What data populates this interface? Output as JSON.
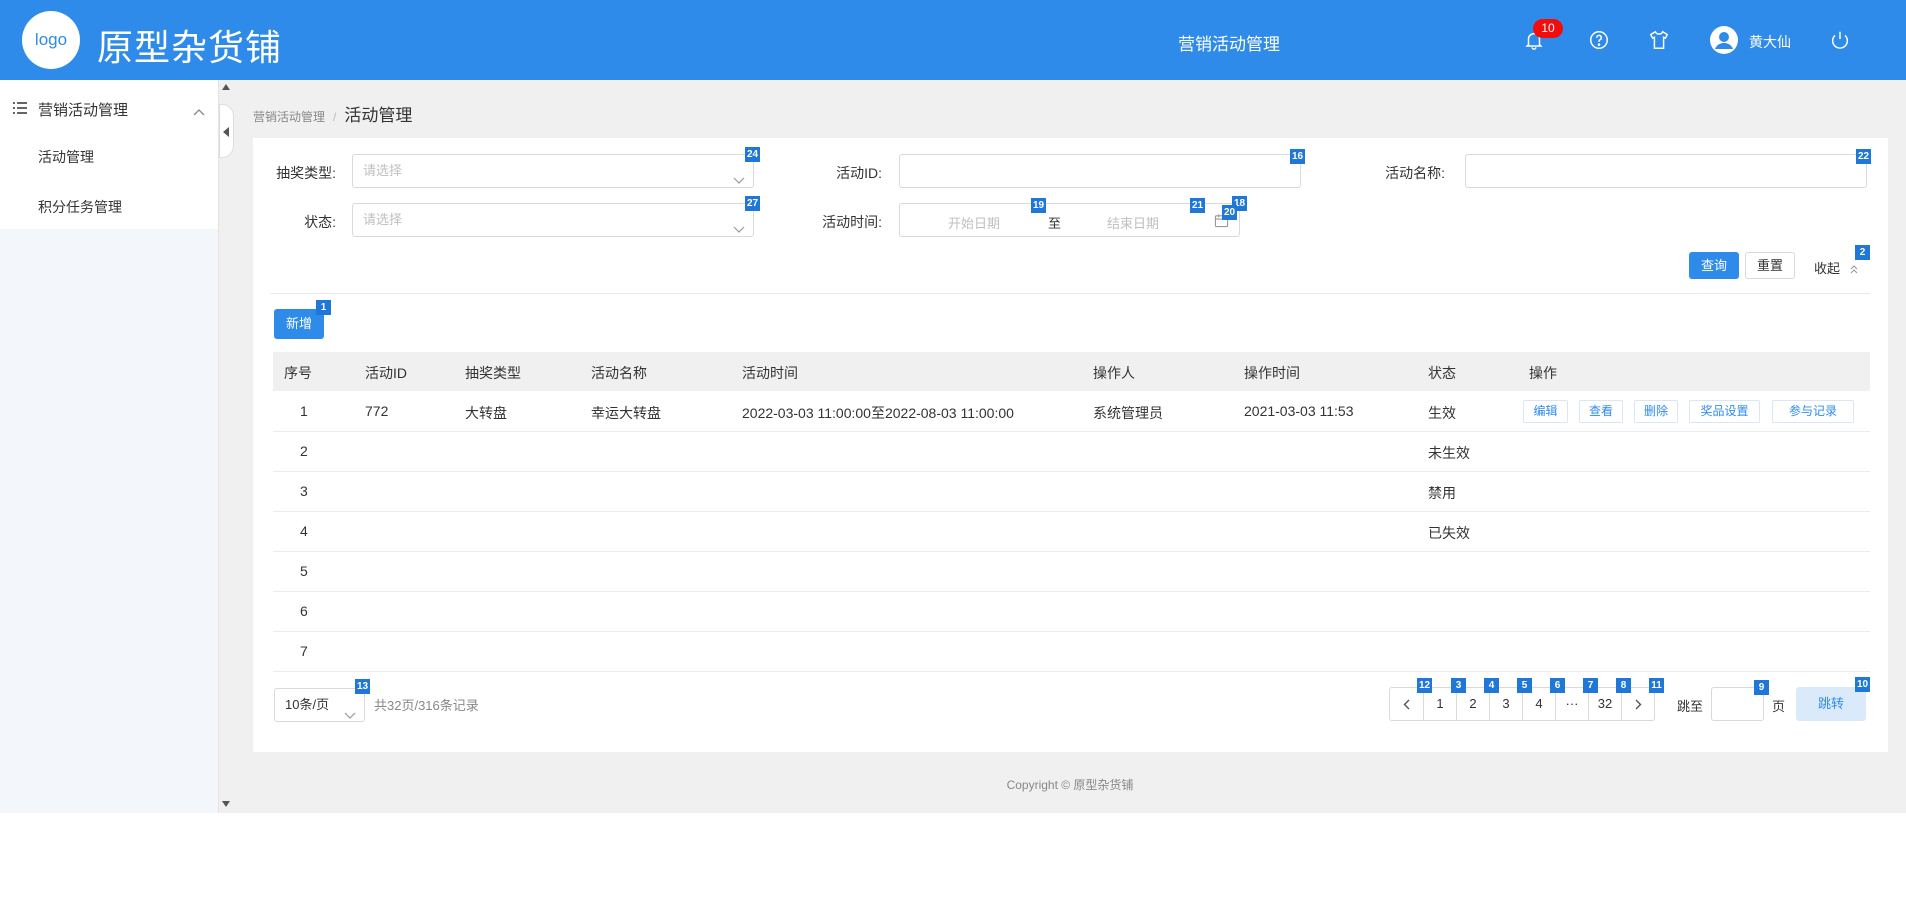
{
  "header": {
    "logo_text": "logo",
    "app_title": "原型杂货铺",
    "center_title": "营销活动管理",
    "notification_count": "10",
    "user_name": "黄大仙"
  },
  "sidebar": {
    "group_label": "营销活动管理",
    "items": [
      {
        "label": "活动管理"
      },
      {
        "label": "积分任务管理"
      }
    ]
  },
  "breadcrumb": {
    "parent": "营销活动管理",
    "separator": "/",
    "current": "活动管理"
  },
  "filters": {
    "lottery_type_label": "抽奖类型:",
    "lottery_type_placeholder": "请选择",
    "activity_id_label": "活动ID:",
    "activity_name_label": "活动名称:",
    "status_label": "状态:",
    "status_placeholder": "请选择",
    "activity_time_label": "活动时间:",
    "start_date_placeholder": "开始日期",
    "range_to": "至",
    "end_date_placeholder": "结束日期",
    "query_button": "查询",
    "reset_button": "重置",
    "collapse_link": "收起"
  },
  "toolbar": {
    "add_button": "新增"
  },
  "table": {
    "columns": [
      "序号",
      "活动ID",
      "抽奖类型",
      "活动名称",
      "活动时间",
      "操作人",
      "操作时间",
      "状态",
      "操作"
    ],
    "rows": [
      {
        "index": "1",
        "activity_id": "772",
        "lottery_type": "大转盘",
        "activity_name": "幸运大转盘",
        "activity_time": "2022-03-03 11:00:00至2022-08-03 11:00:00",
        "operator": "系统管理员",
        "operation_time": "2021-03-03 11:53",
        "status": "生效"
      },
      {
        "index": "2",
        "activity_id": "",
        "lottery_type": "",
        "activity_name": "",
        "activity_time": "",
        "operator": "",
        "operation_time": "",
        "status": "未生效"
      },
      {
        "index": "3",
        "activity_id": "",
        "lottery_type": "",
        "activity_name": "",
        "activity_time": "",
        "operator": "",
        "operation_time": "",
        "status": "禁用"
      },
      {
        "index": "4",
        "activity_id": "",
        "lottery_type": "",
        "activity_name": "",
        "activity_time": "",
        "operator": "",
        "operation_time": "",
        "status": "已失效"
      },
      {
        "index": "5",
        "activity_id": "",
        "lottery_type": "",
        "activity_name": "",
        "activity_time": "",
        "operator": "",
        "operation_time": "",
        "status": ""
      },
      {
        "index": "6",
        "activity_id": "",
        "lottery_type": "",
        "activity_name": "",
        "activity_time": "",
        "operator": "",
        "operation_time": "",
        "status": ""
      },
      {
        "index": "7",
        "activity_id": "",
        "lottery_type": "",
        "activity_name": "",
        "activity_time": "",
        "operator": "",
        "operation_time": "",
        "status": ""
      }
    ],
    "row_actions": [
      "编辑",
      "查看",
      "删除",
      "奖品设置",
      "参与记录"
    ]
  },
  "pagination": {
    "page_size": "10条/页",
    "total_text": "共32页/316条记录",
    "pages": [
      "1",
      "2",
      "3",
      "4",
      "···",
      "32"
    ],
    "jump_to_label": "跳至",
    "page_unit": "页",
    "jump_button": "跳转"
  },
  "element_tags": {
    "add": "1",
    "collapse": "2",
    "page1": "3",
    "page2": "4",
    "page3": "5",
    "page4": "6",
    "ellipsis": "7",
    "page32": "8",
    "jump_input": "9",
    "jump_button": "10",
    "next": "11",
    "prev": "12",
    "page_size": "13",
    "activity_id": "16",
    "calendar": "18",
    "start_date": "19",
    "calendar_right": "20",
    "end_date": "21",
    "activity_name": "22",
    "lottery_type": "24",
    "status": "27"
  },
  "footer": {
    "copyright": "Copyright © 原型杂货铺"
  },
  "colors": {
    "primary": "#2f8bea",
    "badge": "#f20c0c",
    "tag": "#1f78d8"
  }
}
